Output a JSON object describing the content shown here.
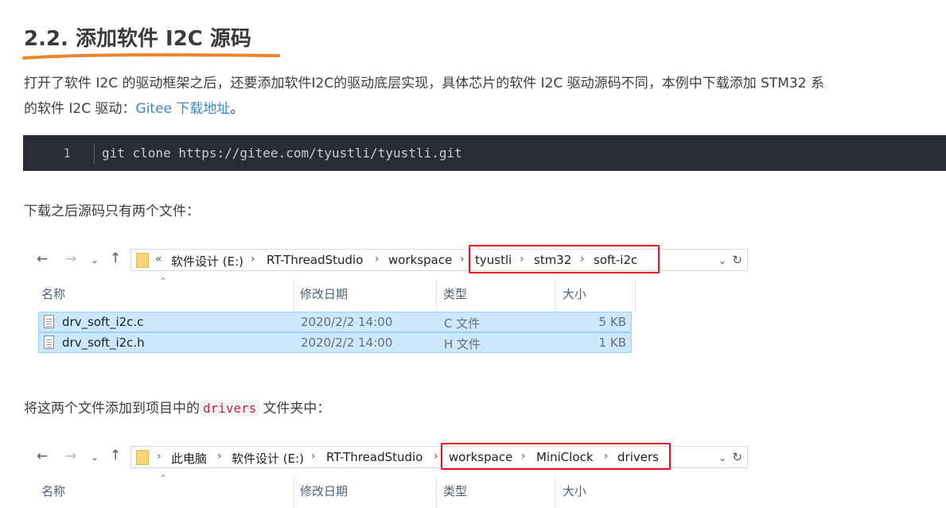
{
  "heading": "2.2. 添加软件 I2C 源码",
  "intro": {
    "line1": "打开了软件 I2C 的驱动框架之后，还要添加软件I2C的驱动底层实现，具体芯片的软件 I2C 驱动源码不同，本例中下载添加 STM32 系",
    "line2_prefix": "的软件 I2C 驱动：",
    "link_text": "Gitee 下载地址",
    "line2_suffix": "。"
  },
  "code": {
    "line_number": "1",
    "command": "git clone https://gitee.com/tyustli/tyustli.git"
  },
  "para_files": "下载之后源码只有两个文件：",
  "explorer1": {
    "crumb_overflow": "«",
    "crumbs": [
      "软件设计 (E:)",
      "RT-ThreadStudio",
      "workspace"
    ],
    "highlighted_crumbs": [
      "tyustli",
      "stm32",
      "soft-i2c"
    ],
    "columns": [
      "名称",
      "修改日期",
      "类型",
      "大小"
    ],
    "files": [
      {
        "name": "drv_soft_i2c.c",
        "date": "2020/2/2 14:00",
        "type": "C 文件",
        "size": "5 KB"
      },
      {
        "name": "drv_soft_i2c.h",
        "date": "2020/2/2 14:00",
        "type": "H 文件",
        "size": "1 KB"
      }
    ]
  },
  "para_add": {
    "prefix": "将这两个文件添加到项目中的",
    "code": "drivers",
    "suffix": "文件夹中："
  },
  "explorer2": {
    "crumbs": [
      "此电脑",
      "软件设计 (E:)",
      "RT-ThreadStudio"
    ],
    "highlighted_crumbs": [
      "workspace",
      "MiniClock",
      "drivers"
    ],
    "columns": [
      "名称",
      "修改日期",
      "类型",
      "大小"
    ]
  },
  "icons": {
    "back": "arrow-left-icon",
    "forward": "arrow-right-icon",
    "recent": "chevron-down-icon",
    "up": "arrow-up-icon",
    "folder": "folder-icon",
    "dropdown": "chevron-down-icon",
    "refresh": "refresh-icon",
    "file": "file-icon"
  },
  "colors": {
    "link": "#3b87c6",
    "code_bg": "#282c34",
    "underline": "#f0842c",
    "highlight_box": "#e81123",
    "selected_row": "#cce8ff"
  }
}
